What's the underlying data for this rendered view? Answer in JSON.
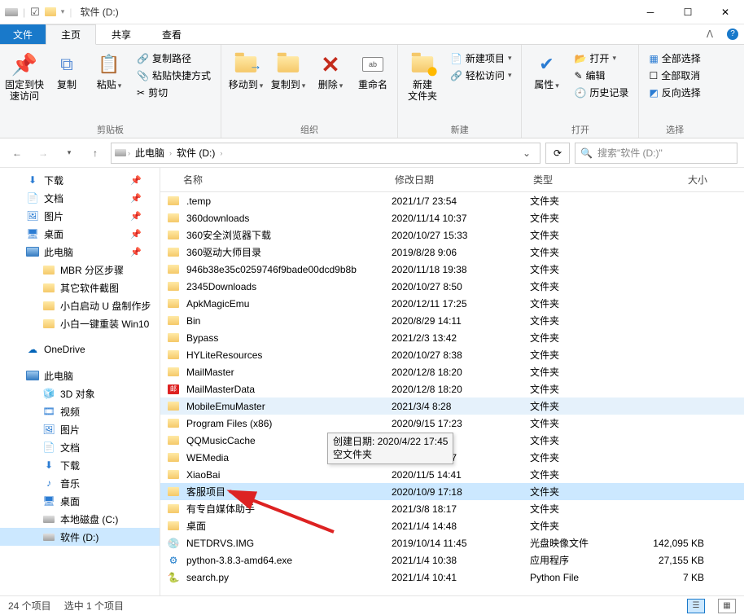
{
  "title": "软件 (D:)",
  "menu": {
    "file": "文件",
    "tabs": [
      "主页",
      "共享",
      "查看"
    ],
    "active": 0
  },
  "ribbon": {
    "groups": {
      "clipboard": {
        "label": "剪贴板",
        "pin": "固定到快\n速访问",
        "copy": "复制",
        "paste": "粘贴",
        "copypath": "复制路径",
        "pasteshortcut": "粘贴快捷方式",
        "cut": "剪切"
      },
      "organize": {
        "label": "组织",
        "moveto": "移动到",
        "copyto": "复制到",
        "delete": "删除",
        "rename": "重命名"
      },
      "new": {
        "label": "新建",
        "newfolder": "新建\n文件夹",
        "newitem": "新建项目",
        "easyaccess": "轻松访问"
      },
      "open": {
        "label": "打开",
        "properties": "属性",
        "open": "打开",
        "edit": "编辑",
        "history": "历史记录"
      },
      "select": {
        "label": "选择",
        "selectall": "全部选择",
        "selectnone": "全部取消",
        "invert": "反向选择"
      }
    }
  },
  "breadcrumb": {
    "root": "此电脑",
    "leaf": "软件 (D:)"
  },
  "search_placeholder": "搜索\"软件 (D:)\"",
  "columns": {
    "name": "名称",
    "date": "修改日期",
    "type": "类型",
    "size": "大小"
  },
  "rows": [
    {
      "icon": "folder",
      "name": ".temp",
      "date": "2021/1/7 23:54",
      "type": "文件夹",
      "size": ""
    },
    {
      "icon": "folder",
      "name": "360downloads",
      "date": "2020/11/14 10:37",
      "type": "文件夹",
      "size": ""
    },
    {
      "icon": "folder",
      "name": "360安全浏览器下载",
      "date": "2020/10/27 15:33",
      "type": "文件夹",
      "size": ""
    },
    {
      "icon": "folder",
      "name": "360驱动大师目录",
      "date": "2019/8/28 9:06",
      "type": "文件夹",
      "size": ""
    },
    {
      "icon": "folder",
      "name": "946b38e35c0259746f9bade00dcd9b8b",
      "date": "2020/11/18 19:38",
      "type": "文件夹",
      "size": ""
    },
    {
      "icon": "folder",
      "name": "2345Downloads",
      "date": "2020/10/27 8:50",
      "type": "文件夹",
      "size": ""
    },
    {
      "icon": "folder",
      "name": "ApkMagicEmu",
      "date": "2020/12/11 17:25",
      "type": "文件夹",
      "size": ""
    },
    {
      "icon": "folder",
      "name": "Bin",
      "date": "2020/8/29 14:11",
      "type": "文件夹",
      "size": ""
    },
    {
      "icon": "folder",
      "name": "Bypass",
      "date": "2021/2/3 13:42",
      "type": "文件夹",
      "size": ""
    },
    {
      "icon": "folder",
      "name": "HYLiteResources",
      "date": "2020/10/27 8:38",
      "type": "文件夹",
      "size": ""
    },
    {
      "icon": "folder",
      "name": "MailMaster",
      "date": "2020/12/8 18:20",
      "type": "文件夹",
      "size": ""
    },
    {
      "icon": "mail",
      "name": "MailMasterData",
      "date": "2020/12/8 18:20",
      "type": "文件夹",
      "size": ""
    },
    {
      "icon": "folder",
      "name": "MobileEmuMaster",
      "date": "2021/3/4 8:28",
      "type": "文件夹",
      "size": "",
      "highlight": true
    },
    {
      "icon": "folder",
      "name": "Program Files (x86)",
      "date": "2020/9/15 17:23",
      "type": "文件夹",
      "size": ""
    },
    {
      "icon": "folder",
      "name": "QQMusicCache",
      "date": "                                              04",
      "type": "文件夹",
      "size": ""
    },
    {
      "icon": "folder",
      "name": "WEMedia",
      "date": "2020/8/12 9:17",
      "type": "文件夹",
      "size": ""
    },
    {
      "icon": "folder",
      "name": "XiaoBai",
      "date": "2020/11/5 14:41",
      "type": "文件夹",
      "size": ""
    },
    {
      "icon": "folder",
      "name": "客服项目",
      "date": "2020/10/9 17:18",
      "type": "文件夹",
      "size": "",
      "selected": true
    },
    {
      "icon": "folder",
      "name": "有专自媒体助手",
      "date": "2021/3/8 18:17",
      "type": "文件夹",
      "size": ""
    },
    {
      "icon": "folder",
      "name": "桌面",
      "date": "2021/1/4 14:48",
      "type": "文件夹",
      "size": ""
    },
    {
      "icon": "disc",
      "name": "NETDRVS.IMG",
      "date": "2019/10/14 11:45",
      "type": "光盘映像文件",
      "size": "142,095 KB"
    },
    {
      "icon": "exe",
      "name": "python-3.8.3-amd64.exe",
      "date": "2021/1/4 10:38",
      "type": "应用程序",
      "size": "27,155 KB"
    },
    {
      "icon": "py",
      "name": "search.py",
      "date": "2021/1/4 10:41",
      "type": "Python File",
      "size": "7 KB"
    }
  ],
  "sidebar": [
    {
      "icon": "down",
      "label": "下载",
      "pin": true
    },
    {
      "icon": "doc",
      "label": "文档",
      "pin": true
    },
    {
      "icon": "pic",
      "label": "图片",
      "pin": true
    },
    {
      "icon": "desk",
      "label": "桌面",
      "pin": true
    },
    {
      "icon": "pc",
      "label": "此电脑",
      "pin": true
    },
    {
      "icon": "folder",
      "label": "MBR 分区步骤",
      "indent": true
    },
    {
      "icon": "folder",
      "label": "其它软件截图",
      "indent": true
    },
    {
      "icon": "folder",
      "label": "小白启动 U 盘制作步",
      "indent": true
    },
    {
      "icon": "folder",
      "label": "小白一键重装 Win10",
      "indent": true
    },
    {
      "icon": "cloud",
      "label": "OneDrive",
      "spacer_before": true
    },
    {
      "icon": "pc",
      "label": "此电脑",
      "spacer_before": true
    },
    {
      "icon": "3d",
      "label": "3D 对象",
      "indent": true
    },
    {
      "icon": "video",
      "label": "视频",
      "indent": true
    },
    {
      "icon": "pic",
      "label": "图片",
      "indent": true
    },
    {
      "icon": "doc",
      "label": "文档",
      "indent": true
    },
    {
      "icon": "down",
      "label": "下载",
      "indent": true
    },
    {
      "icon": "music",
      "label": "音乐",
      "indent": true
    },
    {
      "icon": "desk",
      "label": "桌面",
      "indent": true
    },
    {
      "icon": "drive",
      "label": "本地磁盘 (C:)",
      "indent": true
    },
    {
      "icon": "drive",
      "label": "软件 (D:)",
      "indent": true,
      "selected": true
    }
  ],
  "status": {
    "count": "24 个项目",
    "selected": "选中 1 个项目"
  },
  "tooltip": {
    "line1": "创建日期: 2020/4/22 17:45",
    "line2": "空文件夹"
  }
}
